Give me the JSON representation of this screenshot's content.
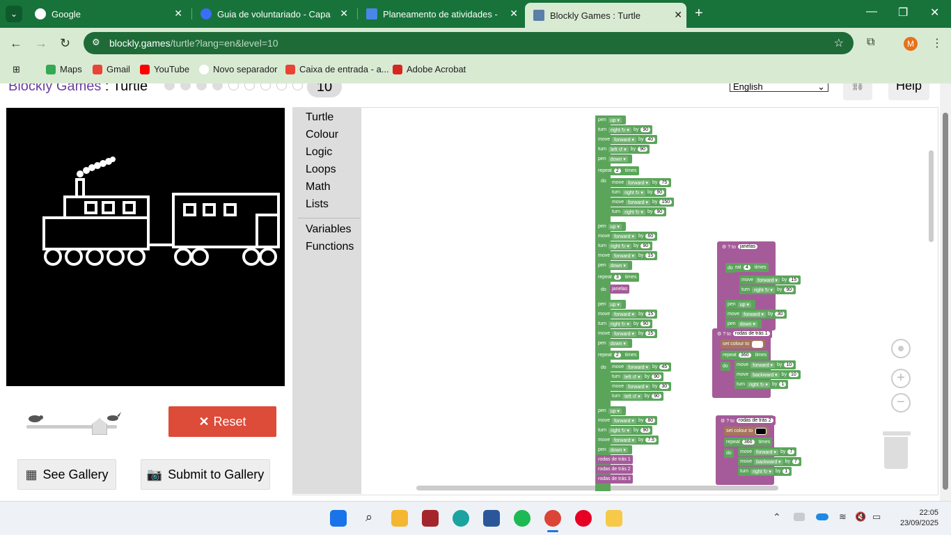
{
  "browser": {
    "tabs": [
      {
        "title": "Google",
        "active": false
      },
      {
        "title": "Guia de voluntariado - Capa de",
        "active": false
      },
      {
        "title": "Planeamento de atividades - Go",
        "active": false
      },
      {
        "title": "Blockly Games : Turtle",
        "active": true
      }
    ],
    "new_tab": "+",
    "url_host": "blockly.games",
    "url_path": "/turtle?lang=en&level=10",
    "profile_initial": "M",
    "bookmarks": [
      "Maps",
      "Gmail",
      "YouTube",
      "Novo separador",
      "Caixa de entrada - a...",
      "Adobe Acrobat"
    ]
  },
  "app": {
    "brand": "Blockly Games",
    "separator": " : ",
    "game": "Turtle",
    "level": "10",
    "language": "English",
    "help": "Help",
    "reset": "Reset",
    "see_gallery": "See Gallery",
    "submit_gallery": "Submit to Gallery",
    "speed": 0.8
  },
  "toolbox": [
    "Turtle",
    "Colour",
    "Logic",
    "Loops",
    "Math",
    "Lists",
    "Variables",
    "Functions"
  ],
  "blocks": {
    "main": [
      {
        "text": "pen",
        "dd": "up"
      },
      {
        "text": "turn",
        "dd": "right ↻",
        "by": "90"
      },
      {
        "text": "move",
        "dd": "forward",
        "by": "40"
      },
      {
        "text": "turn",
        "dd": "left ↺",
        "by": "90"
      },
      {
        "text": "pen",
        "dd": "down"
      },
      {
        "text": "repeat",
        "num": "2",
        "after": "times"
      },
      {
        "text": "move",
        "dd": "forward",
        "by": "75"
      },
      {
        "text": "turn",
        "dd": "right ↻",
        "by": "90"
      },
      {
        "text": "move",
        "dd": "forward",
        "by": "150"
      },
      {
        "text": "turn",
        "dd": "right ↻",
        "by": "90"
      },
      {
        "text": "pen",
        "dd": "up"
      },
      {
        "text": "move",
        "dd": "forward",
        "by": "60"
      },
      {
        "text": "turn",
        "dd": "right ↻",
        "by": "90"
      },
      {
        "text": "move",
        "dd": "forward",
        "by": "15"
      },
      {
        "text": "pen",
        "dd": "down"
      },
      {
        "text": "repeat",
        "num": "3",
        "after": "times"
      },
      {
        "text": "janelas"
      },
      {
        "text": "pen",
        "dd": "up"
      },
      {
        "text": "move",
        "dd": "forward",
        "by": "15"
      },
      {
        "text": "turn",
        "dd": "right ↻",
        "by": "90"
      },
      {
        "text": "move",
        "dd": "forward",
        "by": "15"
      },
      {
        "text": "pen",
        "dd": "down"
      },
      {
        "text": "repeat",
        "num": "2",
        "after": "times"
      },
      {
        "text": "move",
        "dd": "forward",
        "by": "45"
      },
      {
        "text": "turn",
        "dd": "left ↺",
        "by": "90"
      },
      {
        "text": "move",
        "dd": "forward",
        "by": "30"
      },
      {
        "text": "turn",
        "dd": "left ↺",
        "by": "90"
      },
      {
        "text": "pen",
        "dd": "up"
      },
      {
        "text": "move",
        "dd": "forward",
        "by": "80"
      },
      {
        "text": "turn",
        "dd": "right ↻",
        "by": "90"
      },
      {
        "text": "move",
        "dd": "forward",
        "by": "7.5"
      },
      {
        "text": "pen",
        "dd": "down"
      },
      {
        "text": "rodas de trás 1"
      },
      {
        "text": "rodas de trás 2"
      },
      {
        "text": "rodas de trás 3"
      }
    ],
    "do_label": "do",
    "by_label": "by",
    "to_label": "to",
    "times_label": "times",
    "set_colour": "set colour to",
    "fn1": {
      "name": "janelas",
      "rows": [
        {
          "text": "repeat",
          "num": "4",
          "after": "times"
        },
        {
          "text": "move",
          "dd": "forward",
          "by": "15"
        },
        {
          "text": "turn",
          "dd": "right ↻",
          "by": "90"
        },
        {
          "text": "pen",
          "dd": "up"
        },
        {
          "text": "move",
          "dd": "forward",
          "by": "30"
        },
        {
          "text": "pen",
          "dd": "down"
        }
      ]
    },
    "fn2": {
      "name": "rodas de trás 1",
      "rows": [
        {
          "text": "repeat",
          "num": "360",
          "after": "times"
        },
        {
          "text": "move",
          "dd": "forward",
          "by": "10"
        },
        {
          "text": "move",
          "dd": "backward",
          "by": "10"
        },
        {
          "text": "turn",
          "dd": "right ↻",
          "by": "1"
        }
      ],
      "colour": "#ffffff"
    },
    "fn3": {
      "name": "rodas de trás 2",
      "rows": [
        {
          "text": "repeat",
          "num": "360",
          "after": "times"
        },
        {
          "text": "move",
          "dd": "forward",
          "by": "7"
        },
        {
          "text": "move",
          "dd": "backward",
          "by": "7"
        },
        {
          "text": "turn",
          "dd": "right ↻",
          "by": "1"
        }
      ],
      "colour": "#000000"
    }
  },
  "taskbar": {
    "time": "22:05",
    "date": "23/09/2025"
  }
}
